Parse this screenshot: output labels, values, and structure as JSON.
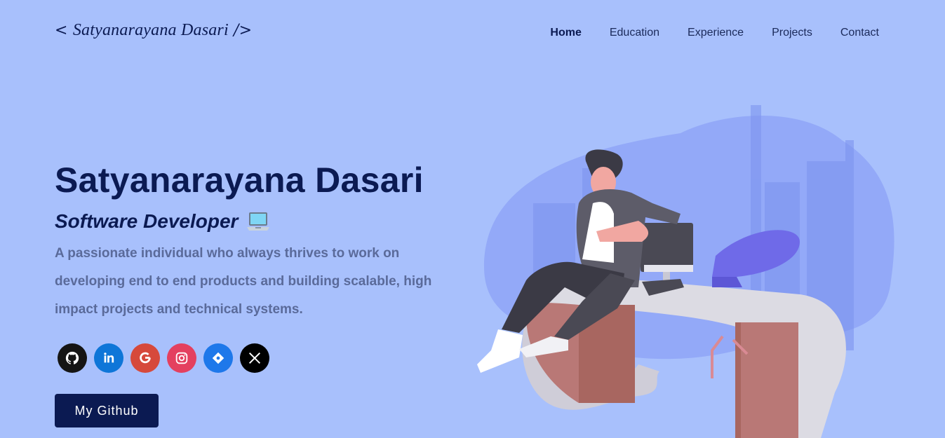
{
  "header": {
    "logo_prefix": "<",
    "logo_name": "Satyanarayana Dasari",
    "logo_suffix": "/>",
    "nav": [
      {
        "label": "Home",
        "active": true
      },
      {
        "label": "Education",
        "active": false
      },
      {
        "label": "Experience",
        "active": false
      },
      {
        "label": "Projects",
        "active": false
      },
      {
        "label": "Contact",
        "active": false
      }
    ]
  },
  "hero": {
    "name": "Satyanarayana Dasari",
    "role": "Software Developer",
    "description": "A passionate individual who always thrives to work on developing end to end products and building scalable, high impact projects and technical systems.",
    "cta_label": "My Github"
  },
  "socials": [
    {
      "icon": "github-icon",
      "color": "#151515"
    },
    {
      "icon": "linkedin-icon",
      "color": "#0e76d8"
    },
    {
      "icon": "google-icon",
      "color": "#d6493b"
    },
    {
      "icon": "instagram-icon",
      "color": "#e4405f"
    },
    {
      "icon": "codeforces-icon",
      "color": "#1e78ea"
    },
    {
      "icon": "x-icon",
      "color": "#000000"
    }
  ],
  "colors": {
    "background": "#a8c0fc",
    "primary": "#0b1a52",
    "muted_text": "#5a6a9a"
  }
}
